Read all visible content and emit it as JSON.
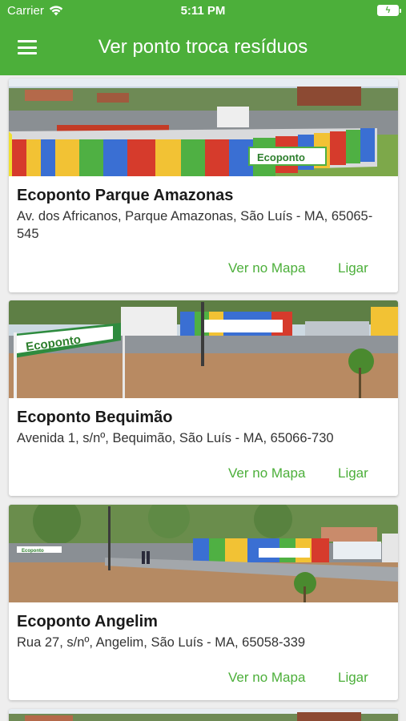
{
  "status_bar": {
    "carrier": "Carrier",
    "time": "5:11 PM"
  },
  "header": {
    "title": "Ver ponto troca resíduos",
    "color": "#4caf3a"
  },
  "points": [
    {
      "name": "Ecoponto Parque Amazonas",
      "address": "Av. dos Africanos, Parque Amazonas, São Luís - MA, 65065-545",
      "map_label": "Ver no Mapa",
      "call_label": "Ligar",
      "sign_text": "Ecoponto"
    },
    {
      "name": "Ecoponto Bequimão",
      "address": "Avenida 1, s/nº, Bequimão, São Luís - MA, 65066-730",
      "map_label": "Ver no Mapa",
      "call_label": "Ligar",
      "sign_text": "Ecoponto"
    },
    {
      "name": "Ecoponto Angelim",
      "address": "Rua 27, s/nº, Angelim, São Luís - MA, 65058-339",
      "map_label": "Ver no Mapa",
      "call_label": "Ligar",
      "sign_text": "Ecoponto"
    }
  ]
}
